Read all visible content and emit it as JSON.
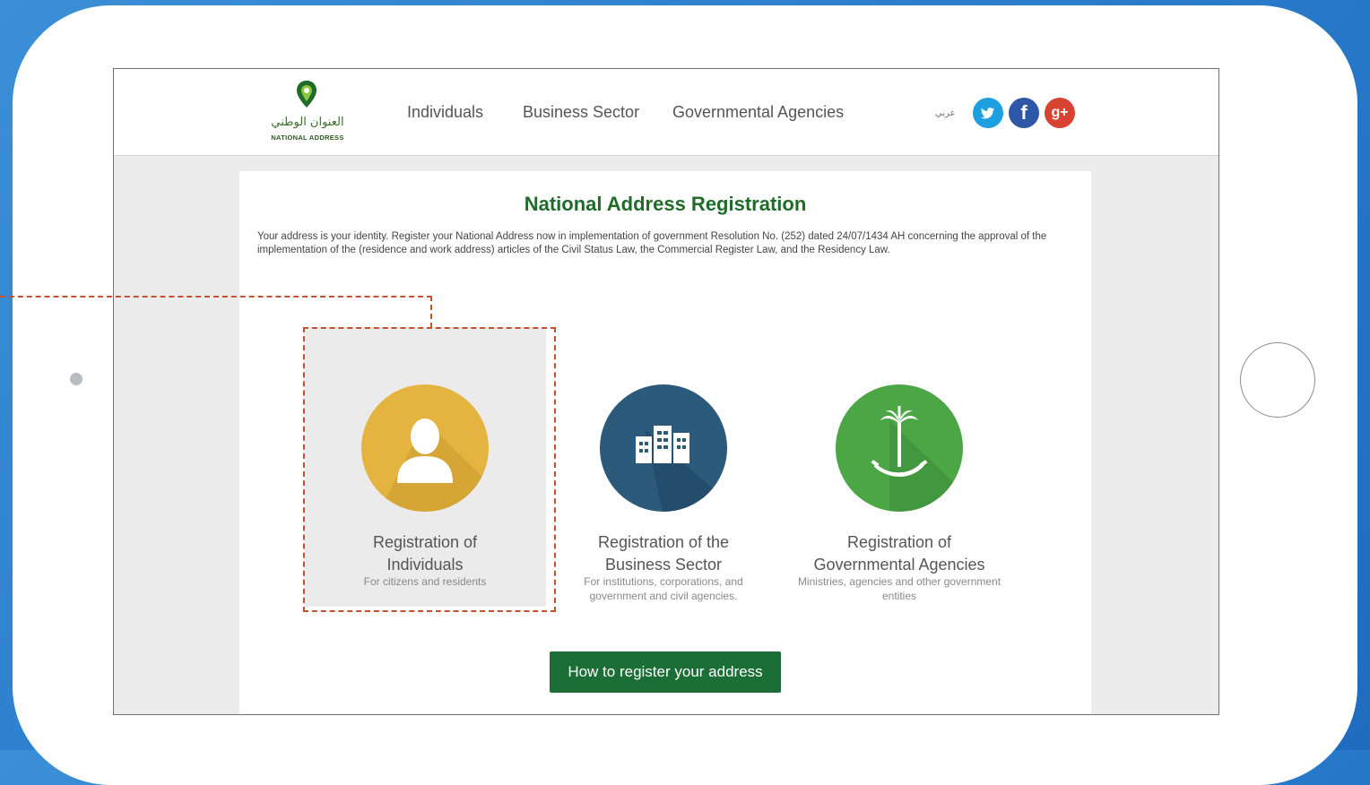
{
  "header": {
    "logo": {
      "arabic_text": "العنوان الوطني",
      "english_text": "NATIONAL ADDRESS"
    },
    "nav": [
      {
        "label": "Individuals"
      },
      {
        "label": "Business Sector"
      },
      {
        "label": "Governmental Agencies"
      }
    ],
    "language_toggle": "عربي",
    "social": [
      {
        "name": "twitter-icon",
        "color": "#1d9fe0"
      },
      {
        "name": "facebook-icon",
        "label": "f",
        "color": "#2f57a8"
      },
      {
        "name": "google-plus-icon",
        "label": "g+",
        "color": "#d64431"
      }
    ]
  },
  "main": {
    "title": "National Address Registration",
    "intro": "Your address is your identity. Register your National Address now in implementation of government Resolution No. (252) dated 24/07/1434 AH concerning the approval of the implementation of the (residence and work address) articles of the Civil Status Law, the Commercial Register Law, and the Residency Law.",
    "cards": [
      {
        "title_line1": "Registration of",
        "title_line2": "Individuals",
        "subtitle": "For citizens and residents",
        "icon": "person-icon",
        "color": "#e5b440",
        "selected": true
      },
      {
        "title_line1": "Registration of the",
        "title_line2": "Business Sector",
        "subtitle": "For institutions, corporations, and government and civil agencies.",
        "icon": "building-icon",
        "color": "#2c5a7a",
        "selected": false
      },
      {
        "title_line1": "Registration of",
        "title_line2": "Governmental Agencies",
        "subtitle": "Ministries, agencies and other government entities",
        "icon": "palm-swords-emblem-icon",
        "color": "#4ca646",
        "selected": false
      }
    ],
    "cta_label": "How to register your address"
  },
  "colors": {
    "background": "#2a7ccc",
    "title_green": "#1f6b2a",
    "cta_green": "#1b6e35",
    "highlight_dash": "#c4512f"
  }
}
